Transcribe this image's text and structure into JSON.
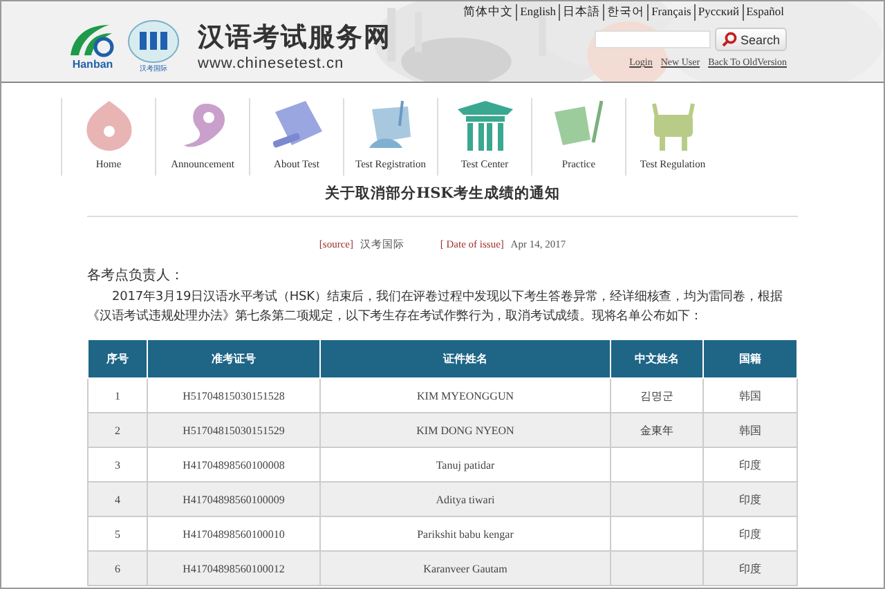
{
  "header": {
    "logos": [
      "Hanban",
      "汉考国际"
    ],
    "site_title": "汉语考试服务网",
    "site_url": "www.chinesetest.cn",
    "languages": [
      "简体中文",
      "English",
      "日本語",
      "한국어",
      "Français",
      "Русский",
      "Español"
    ],
    "search": {
      "button": "Search"
    },
    "account_links": [
      "Login",
      "New User",
      "Back To OldVersion"
    ]
  },
  "nav": [
    {
      "label": "Home",
      "kind": "home"
    },
    {
      "label": "Announcement",
      "kind": "swirl"
    },
    {
      "label": "About Test",
      "kind": "scroll"
    },
    {
      "label": "Test Registration",
      "kind": "fan"
    },
    {
      "label": "Test Center",
      "kind": "gate"
    },
    {
      "label": "Practice",
      "kind": "brush"
    },
    {
      "label": "Test Regulation",
      "kind": "vessel"
    }
  ],
  "article": {
    "title": "关于取消部分HSK考生成绩的通知",
    "meta": [
      {
        "label": "[source]",
        "value": "汉考国际"
      },
      {
        "label": "[ Date of issue]",
        "value": "Apr 14, 2017"
      }
    ],
    "salutation": "各考点负责人：",
    "paragraph": "2017年3月19日汉语水平考试（HSK）结束后，我们在评卷过程中发现以下考生答卷异常，经详细核查，均为雷同卷，根据《汉语考试违规处理办法》第七条第二项规定，以下考生存在考试作弊行为，取消考试成绩。现将名单公布如下：",
    "table": {
      "columns": [
        "序号",
        "准考证号",
        "证件姓名",
        "中文姓名",
        "国籍"
      ],
      "rows": [
        [
          "1",
          "H51704815030151528",
          "KIM MYEONGGUN",
          "김명군",
          "韩国"
        ],
        [
          "2",
          "H51704815030151529",
          "KIM DONG NYEON",
          "金東年",
          "韩国"
        ],
        [
          "3",
          "H41704898560100008",
          "Tanuj patidar",
          "",
          "印度"
        ],
        [
          "4",
          "H41704898560100009",
          "Aditya tiwari",
          "",
          "印度"
        ],
        [
          "5",
          "H41704898560100010",
          "Parikshit babu kengar",
          "",
          "印度"
        ],
        [
          "6",
          "H41704898560100012",
          "Karanveer Gautam",
          "",
          "印度"
        ]
      ]
    }
  }
}
